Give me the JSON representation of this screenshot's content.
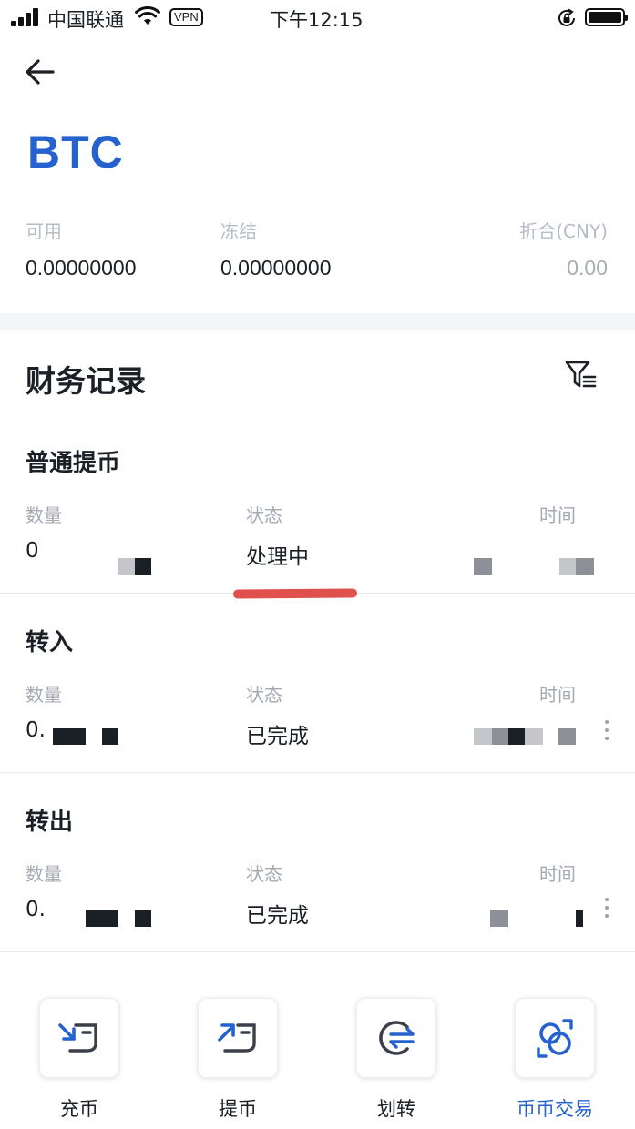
{
  "status_bar": {
    "carrier": "中国联通",
    "vpn": "VPN",
    "time": "下午12:15"
  },
  "coin": "BTC",
  "balances": [
    {
      "label": "可用",
      "value": "0.00000000"
    },
    {
      "label": "冻结",
      "value": "0.00000000"
    },
    {
      "label": "折合(CNY)",
      "value": "0.00"
    }
  ],
  "section_title": "财务记录",
  "columns": {
    "amount": "数量",
    "status": "状态",
    "time": "时间"
  },
  "records": [
    {
      "type": "普通提币",
      "amount": "0",
      "status": "处理中"
    },
    {
      "type": "转入",
      "amount": "0.",
      "status": "已完成"
    },
    {
      "type": "转出",
      "amount": "0.",
      "status": "已完成"
    }
  ],
  "tabs": [
    {
      "label": "充币",
      "icon": "deposit-icon"
    },
    {
      "label": "提币",
      "icon": "withdraw-icon"
    },
    {
      "label": "划转",
      "icon": "transfer-icon"
    },
    {
      "label": "币币交易",
      "icon": "exchange-icon"
    }
  ],
  "colors": {
    "accent": "#2562cf",
    "annotation_underline": "#e0504d",
    "muted_text": "#a4aab4"
  }
}
